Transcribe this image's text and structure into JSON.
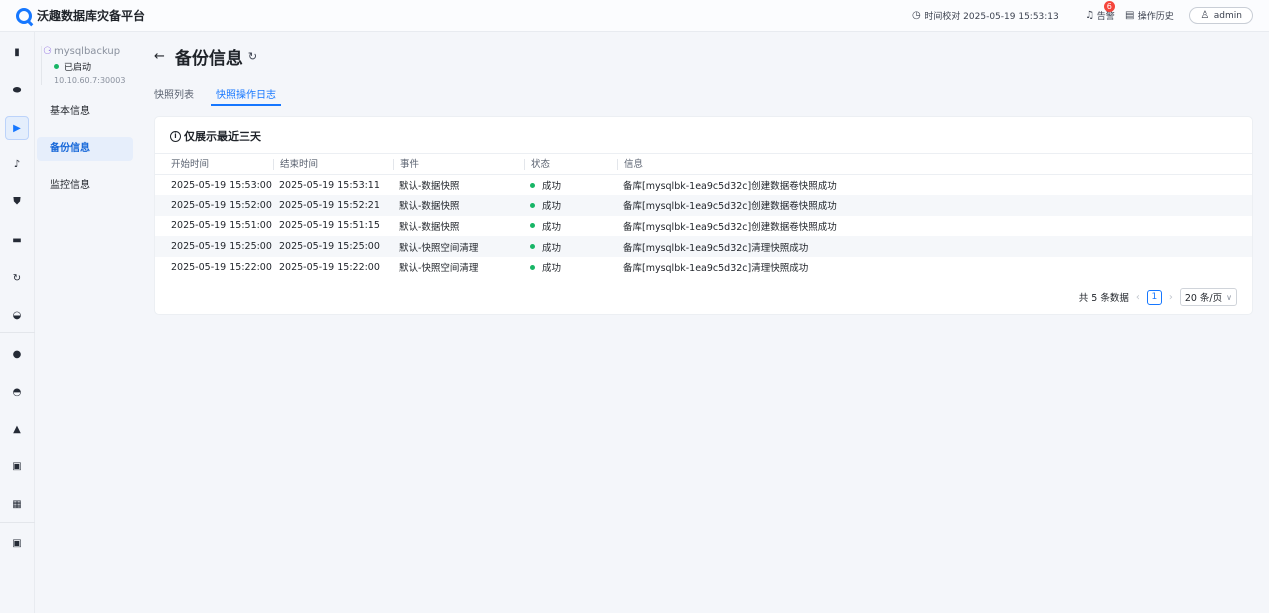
{
  "app": {
    "title": "沃趣数据库灾备平台"
  },
  "topbar": {
    "time_sync": "时间校对 2025-05-19 15:53:13",
    "alarm_label": "告警",
    "alarm_count": "6",
    "history_label": "操作历史",
    "user": "admin"
  },
  "rail": {
    "icons": [
      "chart-icon",
      "database-icon",
      "backup-icon",
      "music-icon",
      "shield-icon",
      "car-icon",
      "loop-icon",
      "speed-icon",
      "location-icon",
      "disk-icon",
      "user-icon",
      "doc-icon",
      "clipboard-icon",
      "monitor-icon"
    ]
  },
  "instance": {
    "name": "mysqlbackup",
    "status": "已启动",
    "address": "10.10.60.7:30003"
  },
  "nav": [
    {
      "label": "基本信息"
    },
    {
      "label": "备份信息"
    },
    {
      "label": "监控信息"
    }
  ],
  "page": {
    "title": "备份信息",
    "tabs": [
      {
        "label": "快照列表"
      },
      {
        "label": "快照操作日志"
      }
    ]
  },
  "card": {
    "notice": "仅展示最近三天",
    "columns": [
      "开始时间",
      "结束时间",
      "事件",
      "状态",
      "信息"
    ],
    "rows": [
      {
        "start": "2025-05-19 15:53:00",
        "end": "2025-05-19 15:53:11",
        "event": "默认-数据快照",
        "status": "成功",
        "info": "备库[mysqlbk-1ea9c5d32c]创建数据卷快照成功"
      },
      {
        "start": "2025-05-19 15:52:00",
        "end": "2025-05-19 15:52:21",
        "event": "默认-数据快照",
        "status": "成功",
        "info": "备库[mysqlbk-1ea9c5d32c]创建数据卷快照成功"
      },
      {
        "start": "2025-05-19 15:51:00",
        "end": "2025-05-19 15:51:15",
        "event": "默认-数据快照",
        "status": "成功",
        "info": "备库[mysqlbk-1ea9c5d32c]创建数据卷快照成功"
      },
      {
        "start": "2025-05-19 15:25:00",
        "end": "2025-05-19 15:25:00",
        "event": "默认-快照空间清理",
        "status": "成功",
        "info": "备库[mysqlbk-1ea9c5d32c]清理快照成功"
      },
      {
        "start": "2025-05-19 15:22:00",
        "end": "2025-05-19 15:22:00",
        "event": "默认-快照空间清理",
        "status": "成功",
        "info": "备库[mysqlbk-1ea9c5d32c]清理快照成功"
      }
    ]
  },
  "pager": {
    "total": "共 5 条数据",
    "current": "1",
    "page_size": "20 条/页"
  },
  "colors": {
    "accent": "#1677ff",
    "success": "#18b566",
    "badge": "#f5453c"
  }
}
